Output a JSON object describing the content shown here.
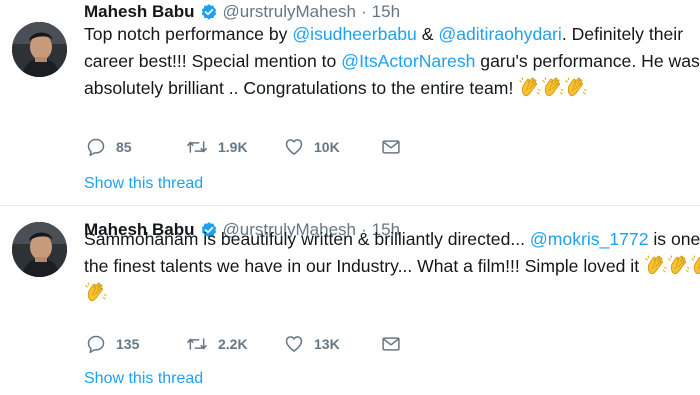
{
  "tweets": [
    {
      "author": {
        "name": "Mahesh Babu",
        "handle": "@urstrulyMahesh",
        "verified": true,
        "avatar": "avatar-photo"
      },
      "separator": "·",
      "time": "15h",
      "text": {
        "line1_a": "Top notch performance by ",
        "mention1": "@isudheerbabu",
        "line1_b": " & ",
        "mention2": "@aditiraohydari",
        "line1_c": ". Definitely their",
        "line2_a": "career best!!! Special mention to ",
        "mention3": "@ItsActorNaresh",
        "line2_b": " garu's performance. He was",
        "line3_a": "absolutely brilliant .. Congratulations to the entire team! "
      },
      "emoji": "clapping-hands",
      "emoji_count": 3,
      "actions": {
        "replies": "85",
        "retweets": "1.9K",
        "likes": "10K"
      },
      "thread_link": "Show this thread"
    },
    {
      "author": {
        "name": "Mahesh Babu",
        "handle": "@urstrulyMahesh",
        "verified": true,
        "avatar": "avatar-photo"
      },
      "separator": "·",
      "time": "15h",
      "text": {
        "line1_a": "Sammohanam is beautifuly written & brilliantly directed... ",
        "mention1": "@mokris_1772",
        "line1_b": " is one of",
        "line2_a": "the finest talents we have in our Industry... What a film!!! Simple loved it "
      },
      "emoji": "clapping-hands",
      "emoji_count": 4,
      "actions": {
        "replies": "135",
        "retweets": "2.2K",
        "likes": "13K"
      },
      "thread_link": "Show this thread"
    }
  ],
  "colors": {
    "link": "#1da1f2",
    "secondary_text": "#657786",
    "primary_text": "#14171a",
    "verified_badge": "#1da1f2",
    "divider": "#e6ecf0"
  },
  "icons": [
    "reply-icon",
    "retweet-icon",
    "like-icon",
    "direct-message-icon",
    "verified-badge-icon",
    "clapping-hands-emoji"
  ]
}
